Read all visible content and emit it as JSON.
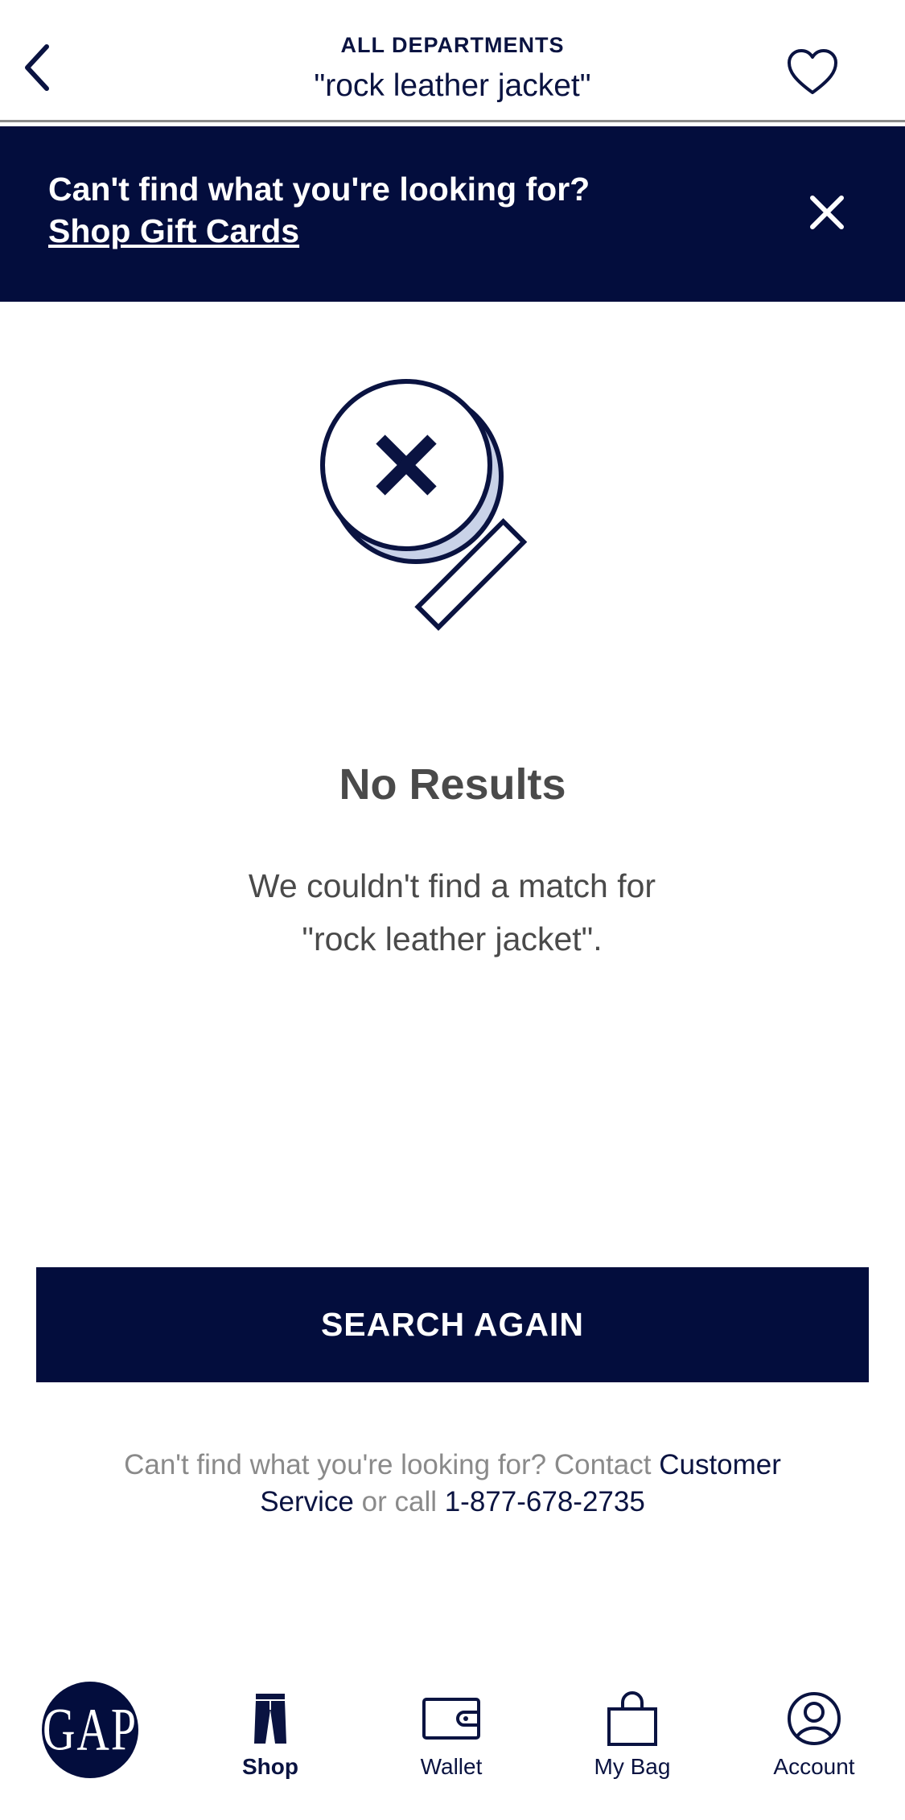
{
  "header": {
    "department": "ALL DEPARTMENTS",
    "query": "\"rock leather jacket\""
  },
  "banner": {
    "message": "Can't find what you're looking for?",
    "link_label": "Shop Gift Cards"
  },
  "empty_state": {
    "title": "No Results",
    "message_line1": "We couldn't find a match for",
    "message_line2": "\"rock leather jacket\"."
  },
  "search_again_label": "SEARCH AGAIN",
  "help": {
    "prefix": "Can't find what you're looking for? Contact ",
    "customer_service": "Customer Service",
    "middle": " or call ",
    "phone": "1-877-678-2735"
  },
  "nav": {
    "logo": "GAP",
    "items": [
      {
        "label": "Shop",
        "icon": "jeans-icon",
        "active": true
      },
      {
        "label": "Wallet",
        "icon": "wallet-icon",
        "active": false
      },
      {
        "label": "My Bag",
        "icon": "shopping-bag-icon",
        "active": false
      },
      {
        "label": "Account",
        "icon": "account-icon",
        "active": false
      }
    ]
  },
  "colors": {
    "navy": "#030d3d",
    "text_navy": "#0a1341",
    "gray_text": "#4a4a4a",
    "muted_text": "#8a8a8a",
    "lens_shadow": "#c9d2e8"
  }
}
